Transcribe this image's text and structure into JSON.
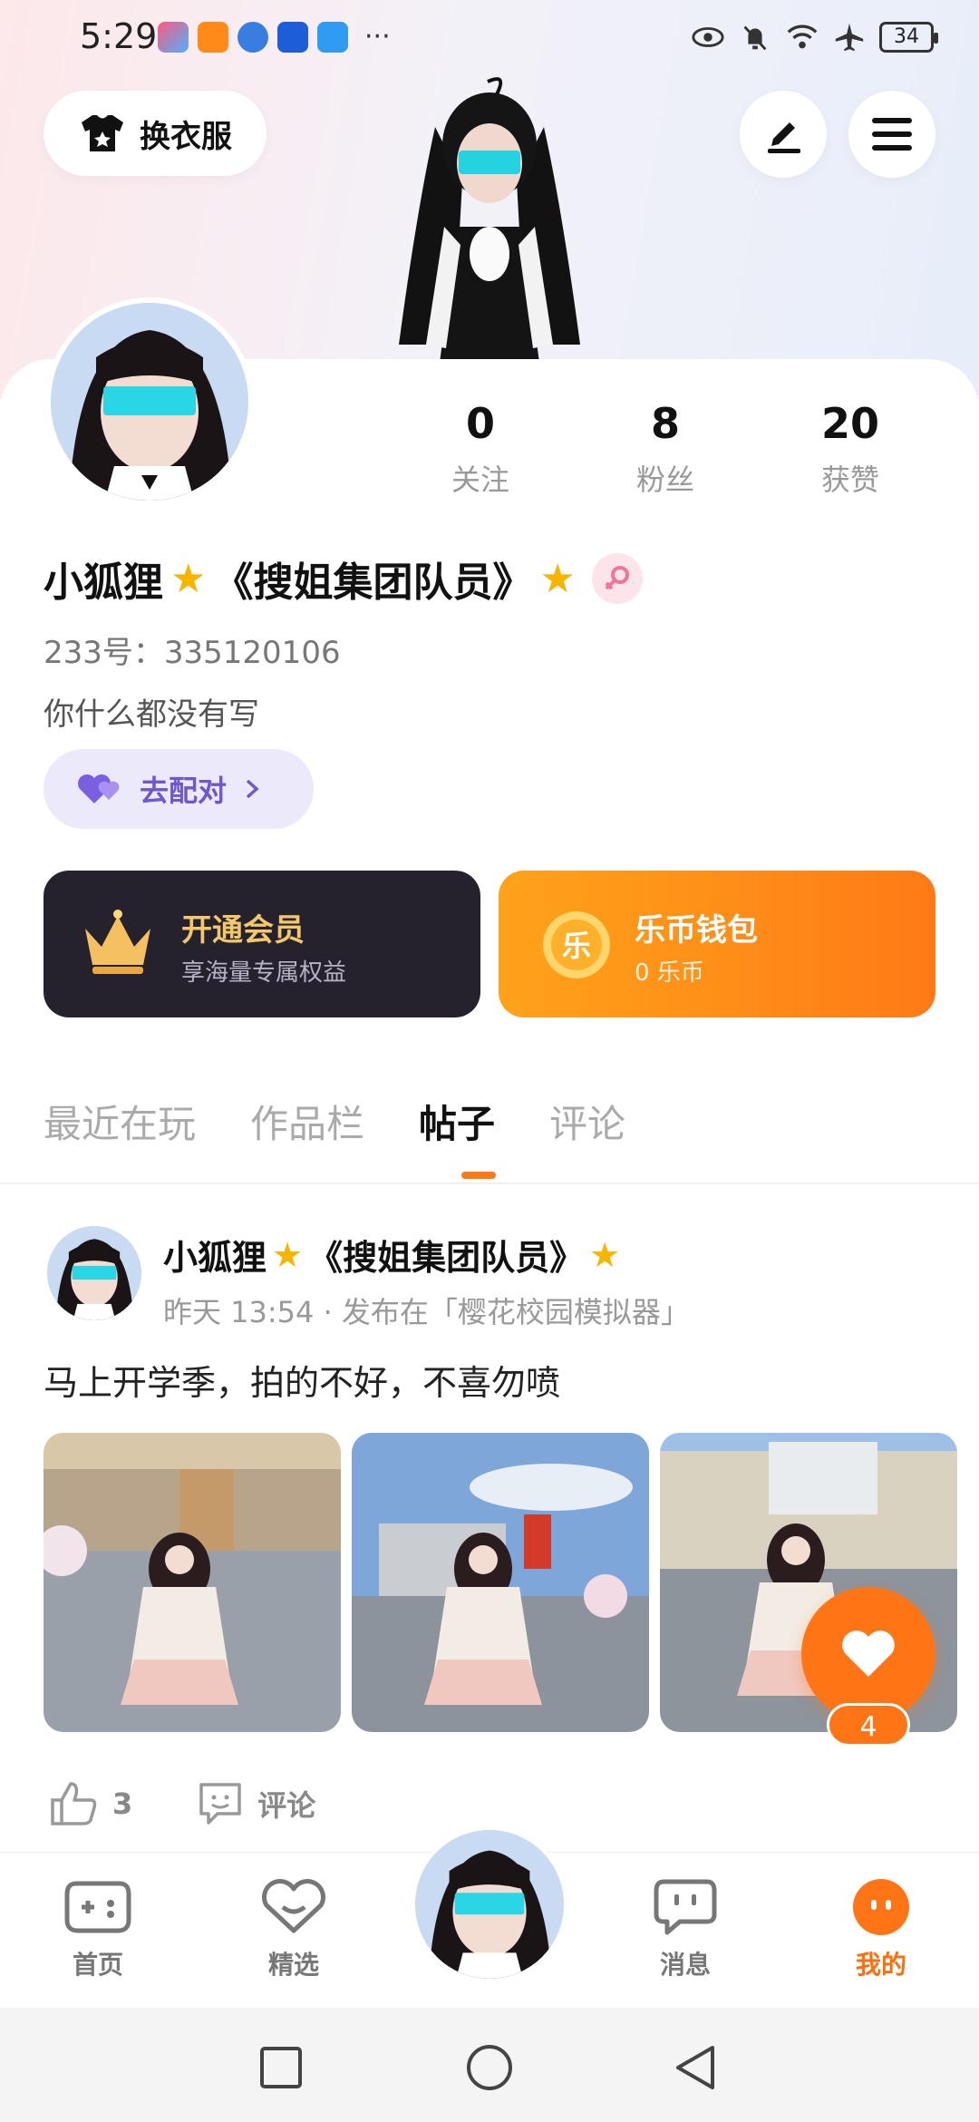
{
  "status_bar": {
    "time": "5:29",
    "more": "···",
    "battery": "34"
  },
  "top_bar": {
    "outfit_label": "换衣服"
  },
  "stats": [
    {
      "num": "0",
      "label": "关注"
    },
    {
      "num": "8",
      "label": "粉丝"
    },
    {
      "num": "20",
      "label": "获赞"
    }
  ],
  "profile": {
    "nickname_pre": "小狐狸",
    "nickname_mid": "《搜姐集团队员》",
    "uid": "233号：335120106",
    "bio": "你什么都没有写",
    "match_label": "去配对"
  },
  "vip": {
    "title": "开通会员",
    "subtitle": "享海量专属权益"
  },
  "wallet": {
    "title": "乐币钱包",
    "subtitle": "0 乐币",
    "coin_char": "乐"
  },
  "tabs": [
    "最近在玩",
    "作品栏",
    "帖子",
    "评论"
  ],
  "post": {
    "author_pre": "小狐狸",
    "author_mid": "《搜姐集团队员》",
    "meta": "昨天 13:54 · 发布在「樱花校园模拟器」",
    "text": "马上开学季，拍的不好，不喜勿喷",
    "likes": "3",
    "comment_label": "评论",
    "fav_count": "4"
  },
  "nav": [
    "首页",
    "精选",
    "消息",
    "我的"
  ],
  "colors": {
    "accent": "#ff7516",
    "vip_bg": "#25222e",
    "match_bg": "#ece9fb"
  }
}
